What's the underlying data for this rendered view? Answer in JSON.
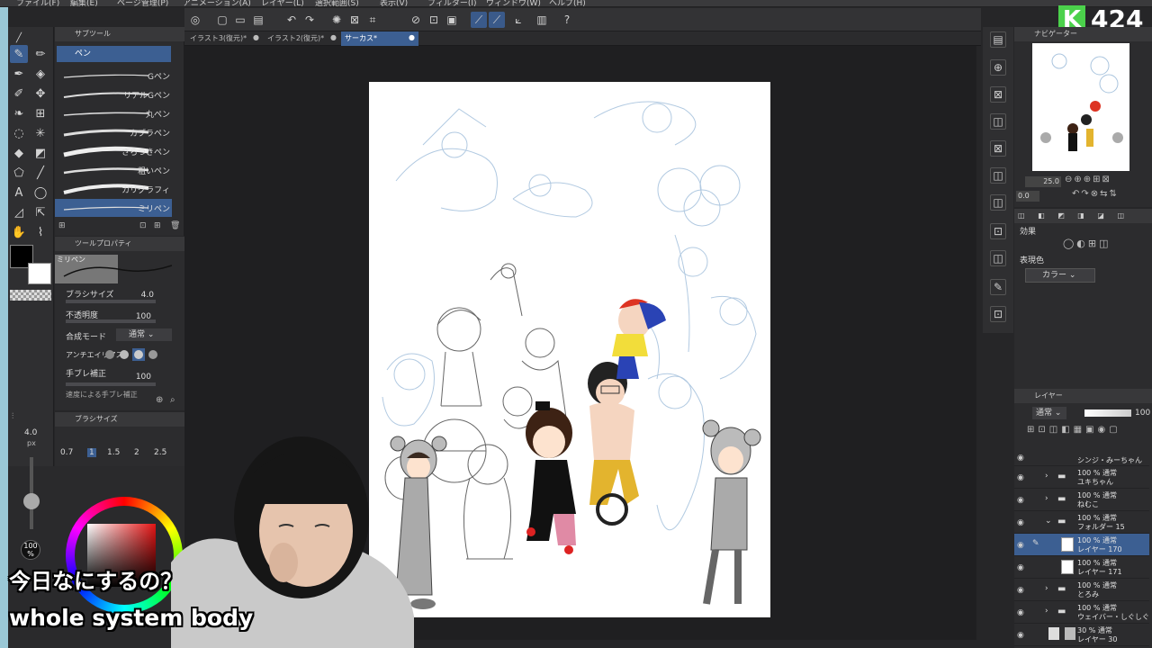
{
  "menu": [
    "ファイル(F)",
    "編集(E)",
    "ページ管理(P)",
    "アニメーション(A)",
    "レイヤー(L)",
    "選択範囲(S)",
    "表示(V)",
    "フィルター(I)",
    "ウィンドウ(W)",
    "ヘルプ(H)"
  ],
  "logo": {
    "letter": "K",
    "number": "424"
  },
  "subtool": {
    "tab_label": "サブツール",
    "group": "ペン",
    "brushes": [
      "Gペン",
      "リアルGペン",
      "丸ペン",
      "カブラペン",
      "さらつきペン",
      "粗いペン",
      "カリグラフィ",
      "ミリペン"
    ],
    "selected_index": 7
  },
  "tool_property": {
    "tab_label": "ツールプロパティ",
    "preview_label": "ミリペン",
    "rows": [
      {
        "label": "ブラシサイズ",
        "value": "4.0"
      },
      {
        "label": "不透明度",
        "value": "100"
      },
      {
        "label": "合成モード",
        "value": "通常"
      },
      {
        "label": "アンチエイリアス",
        "value": ""
      },
      {
        "label": "手ブレ補正",
        "value": "100"
      },
      {
        "label": "速度による手ブレ補正",
        "value": ""
      }
    ]
  },
  "brush_size": {
    "tab_label": "ブラシサイズ",
    "current": "4.0",
    "unit": "px",
    "presets": [
      "0.7",
      "1",
      "1.5",
      "2",
      "2.5"
    ]
  },
  "color": {
    "main": "#000000",
    "sub": "#ffffff",
    "opacity_label": "100",
    "opacity_unit": "%"
  },
  "doc_tabs": [
    {
      "label": "イラスト3(復元)*",
      "active": false
    },
    {
      "label": "イラスト2(復元)*",
      "active": false
    },
    {
      "label": "サーカス*",
      "active": true
    }
  ],
  "navigator": {
    "tab_label": "ナビゲーター",
    "zoom": "25.0",
    "angle": "0.0"
  },
  "effects": {
    "title": "効果",
    "color_mode_label": "表現色",
    "color_mode_value": "カラー"
  },
  "layers": {
    "tab_label": "レイヤー",
    "blend": "通常",
    "opacity": "100",
    "items": [
      {
        "line1": "シンジ・みーちゃん",
        "line2": "",
        "folder": true,
        "selected": false
      },
      {
        "line1": "100 % 通常",
        "line2": "ユキちゃん",
        "folder": true,
        "selected": false
      },
      {
        "line1": "100 % 通常",
        "line2": "ねむこ",
        "folder": true,
        "selected": false
      },
      {
        "line1": "100 % 通常",
        "line2": "フォルダー 15",
        "folder": true,
        "selected": false
      },
      {
        "line1": "100 % 通常",
        "line2": "レイヤー 170",
        "folder": false,
        "selected": true
      },
      {
        "line1": "100 % 通常",
        "line2": "レイヤー 171",
        "folder": false,
        "selected": false
      },
      {
        "line1": "100 % 通常",
        "line2": "とろみ",
        "folder": true,
        "selected": false
      },
      {
        "line1": "100 % 通常",
        "line2": "ウェイバー・しぐしぐ",
        "folder": true,
        "selected": false
      },
      {
        "line1": "30 % 通常",
        "line2": "レイヤー 30",
        "folder": false,
        "selected": false
      }
    ]
  },
  "captions": {
    "jp": "今日なにするの？",
    "en": "whole system body"
  }
}
